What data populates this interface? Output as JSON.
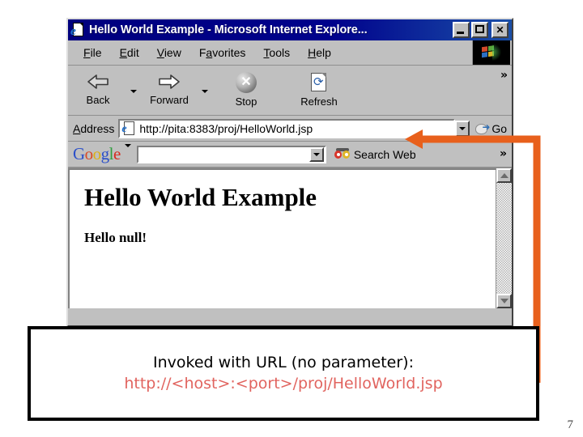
{
  "slide": {
    "page_number": "7"
  },
  "browser": {
    "title": "Hello World Example - Microsoft Internet Explore...",
    "window_icon": "ie-document-icon",
    "window_controls": [
      {
        "name": "minimize",
        "label": "_"
      },
      {
        "name": "maximize",
        "label": "□"
      },
      {
        "name": "close",
        "label": "✕"
      }
    ],
    "menu": [
      {
        "label": "File",
        "accel": "F"
      },
      {
        "label": "Edit",
        "accel": "E"
      },
      {
        "label": "View",
        "accel": "V"
      },
      {
        "label": "Favorites",
        "accel": "a"
      },
      {
        "label": "Tools",
        "accel": "T"
      },
      {
        "label": "Help",
        "accel": "H"
      }
    ],
    "brand_logo": "windows-flag-logo",
    "toolbar": {
      "buttons": [
        {
          "name": "back-button",
          "label": "Back",
          "icon": "left-arrow-icon",
          "has_dropdown": true
        },
        {
          "name": "forward-button",
          "label": "Forward",
          "icon": "right-arrow-icon",
          "has_dropdown": true
        },
        {
          "name": "stop-button",
          "label": "Stop",
          "icon": "stop-x-icon",
          "has_dropdown": false
        },
        {
          "name": "refresh-button",
          "label": "Refresh",
          "icon": "refresh-page-icon",
          "has_dropdown": false
        }
      ],
      "overflow_label": "»"
    },
    "address_bar": {
      "label": "Address",
      "icon": "ie-document-icon",
      "url": "http://pita:8383/proj/HelloWorld.jsp",
      "dropdown_icon": "chevron-down-icon",
      "go_label": "Go",
      "go_icon": "go-arrow-icon"
    },
    "google_toolbar": {
      "logo_letters": [
        "G",
        "o",
        "o",
        "g",
        "l",
        "e"
      ],
      "logo_caret": "chevron-down-icon",
      "search_value": "",
      "search_placeholder": "",
      "field_dropdown_icon": "chevron-down-icon",
      "search_web_label": "Search Web",
      "search_web_icon": "binoculars-icon",
      "overflow_label": "»"
    },
    "page": {
      "heading": "Hello World Example",
      "body": "Hello null!",
      "scrollbar": {
        "up_icon": "triangle-up-icon",
        "down_icon": "triangle-down-icon"
      }
    }
  },
  "annotation": {
    "arrow_color": "#e8601c",
    "target": "address-bar-url",
    "arrow_icon": "left-pointing-elbow-arrow"
  },
  "caption": {
    "line1": "Invoked with URL (no parameter):",
    "line2": "http://<host>:<port>/proj/HelloWorld.jsp",
    "line2_color": "#e1645f",
    "border_color": "#000000"
  }
}
